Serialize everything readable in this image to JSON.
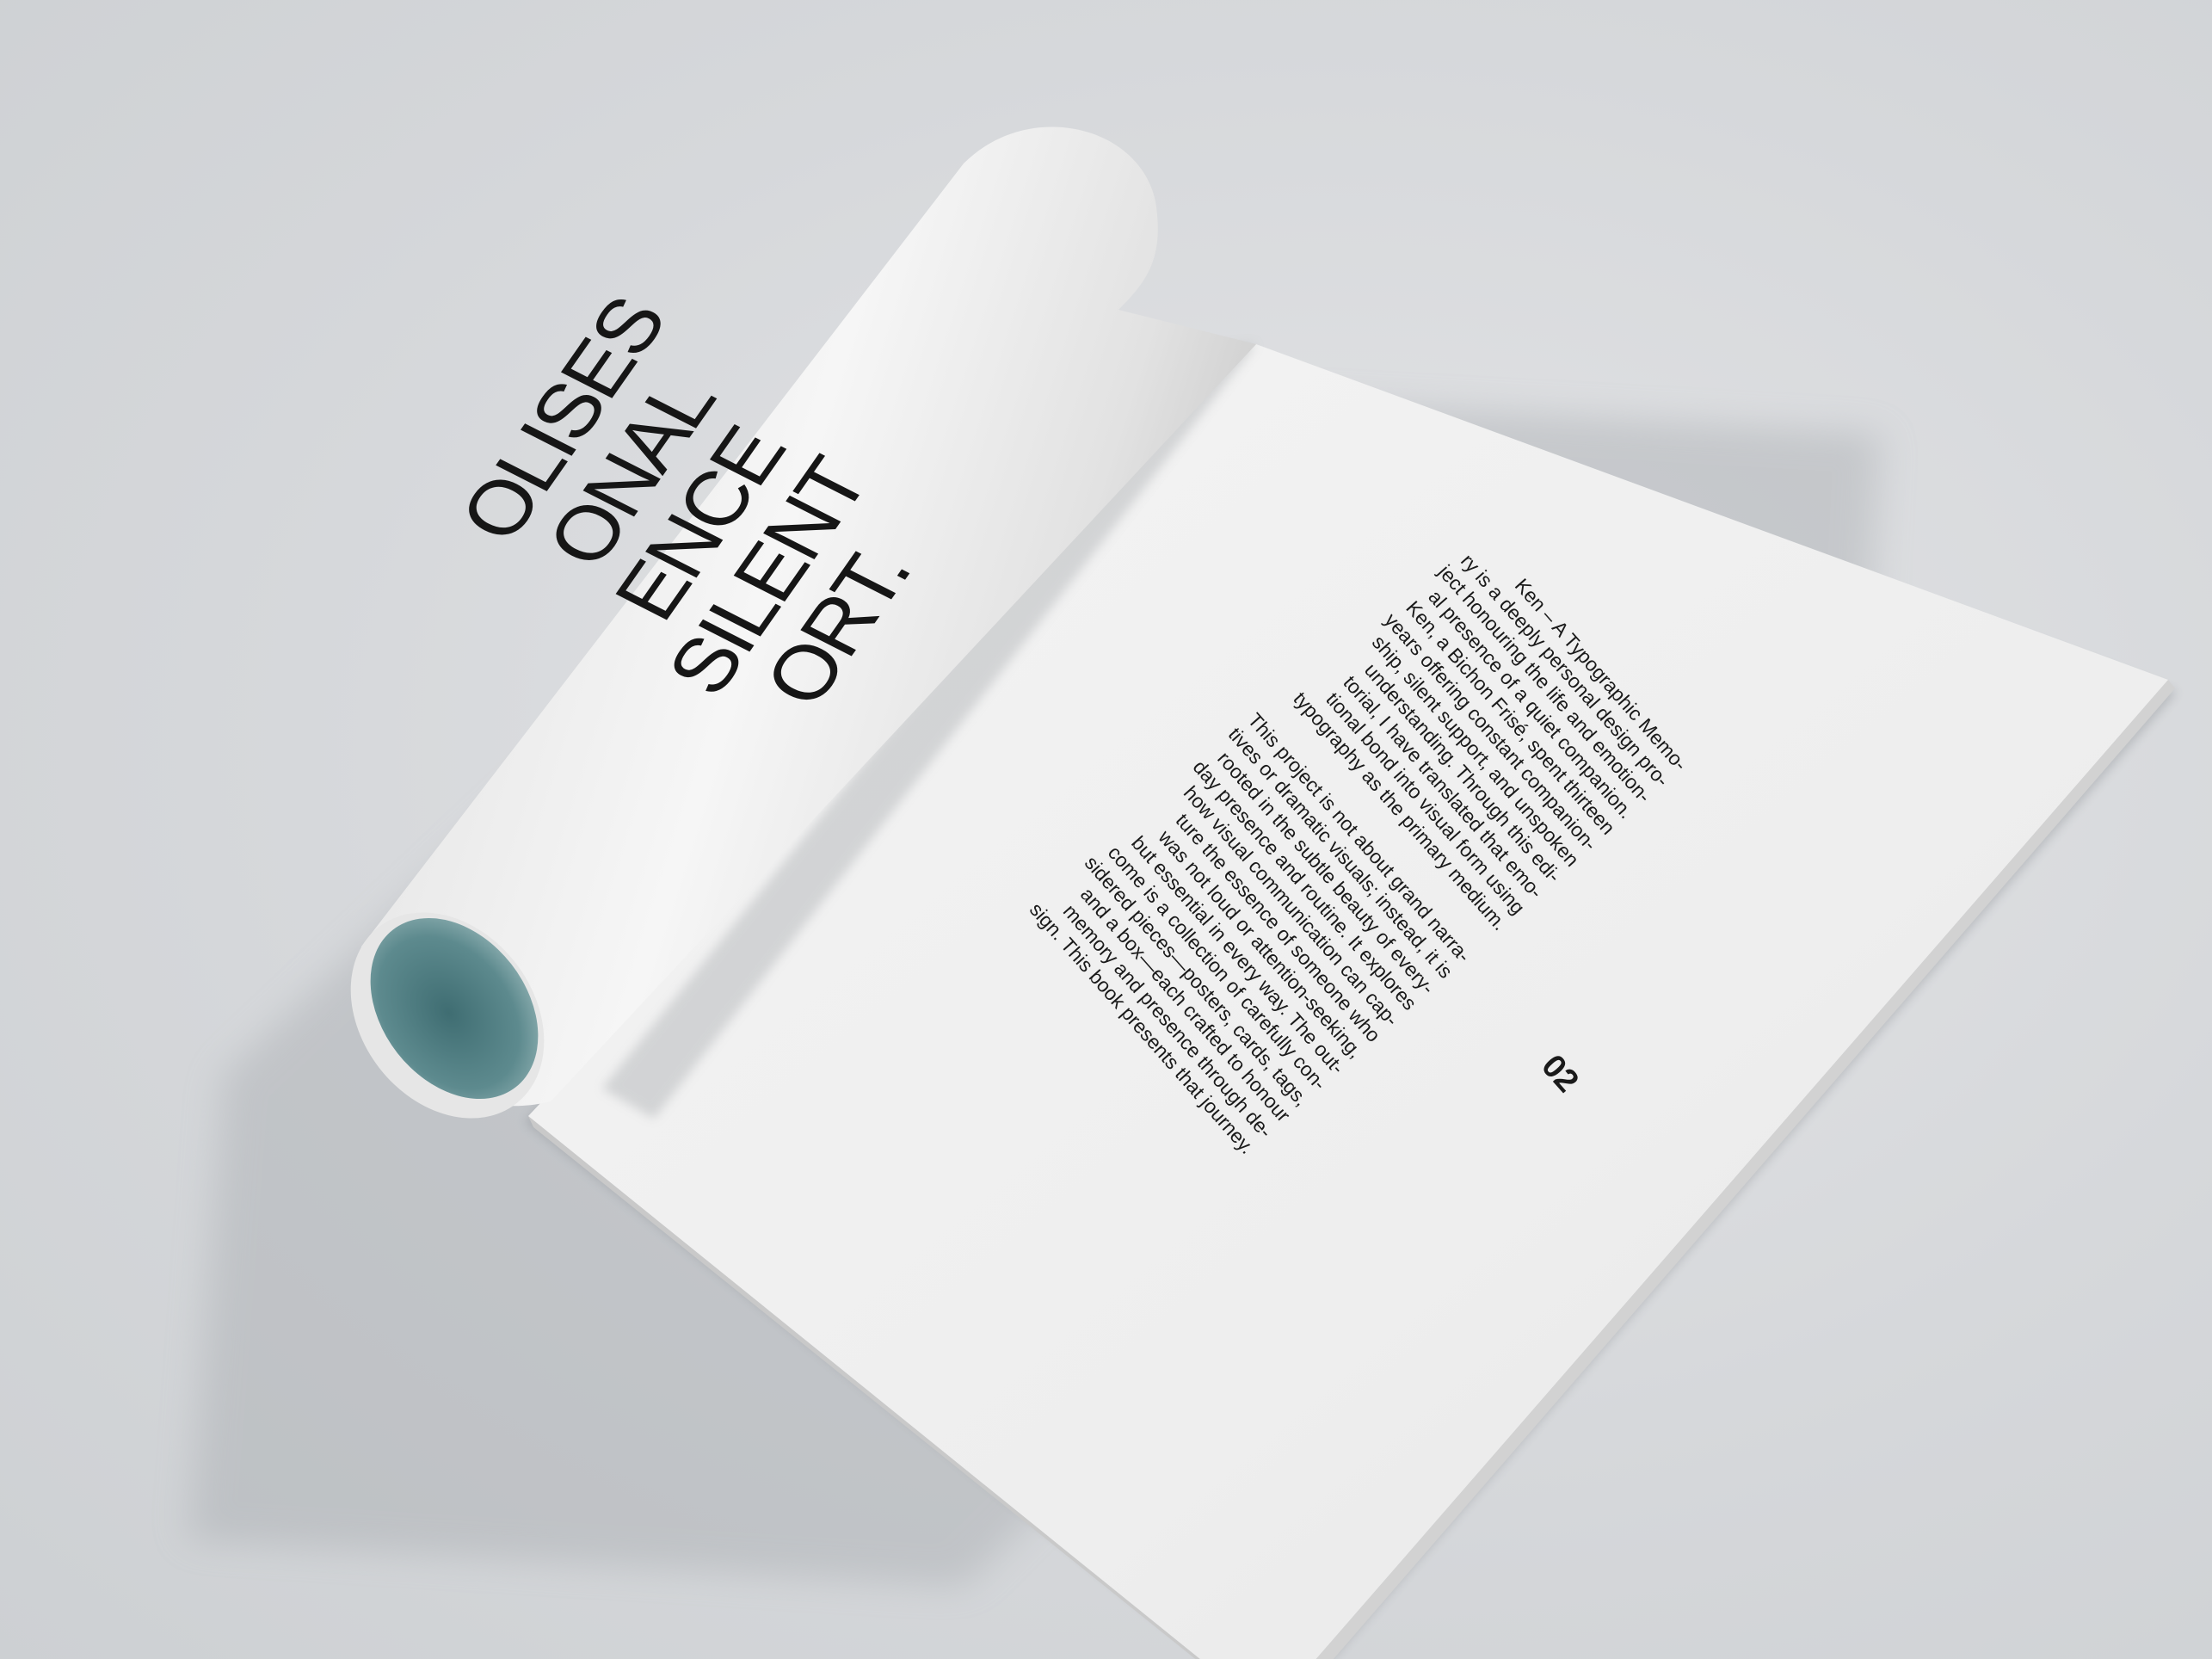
{
  "roll_headline": {
    "lines": [
      "OLISES",
      "ONAL",
      "ENCE",
      "SILENT",
      "ORT."
    ]
  },
  "body": {
    "paragraph_1": [
      "Ken – A Typographic Memo-",
      "ry is a deeply personal design pro-",
      "ject honouring the life and emotion-",
      "al presence of a quiet companion.",
      "Ken, a Bichon Frisé, spent thirteen",
      "years offering constant companion-",
      "ship, silent support, and unspoken",
      "understanding. Through this edi-",
      "torial, I have translated that emo-",
      "tional bond into visual form using",
      "typography as the primary medium."
    ],
    "paragraph_2": [
      "This project is not about grand narra-",
      "tives or dramatic visuals; instead, it is",
      "rooted in the subtle beauty of every-",
      "day presence and routine. It explores",
      "how visual communication can cap-",
      "ture the essence of someone who",
      "was not loud or attention-seeking,",
      "but essential in every way. The out-",
      "come is a collection of carefully con-",
      "sidered pieces—posters, cards, tags,",
      "and a box—each crafted to honour",
      "memory and presence through de-",
      "sign. This book presents that journey."
    ]
  },
  "page_number": "02",
  "colors": {
    "background": "#d8d9dc",
    "paper": "#f1f1f1",
    "ink": "#1a1a1a",
    "roll_inside": "#5a8589"
  }
}
